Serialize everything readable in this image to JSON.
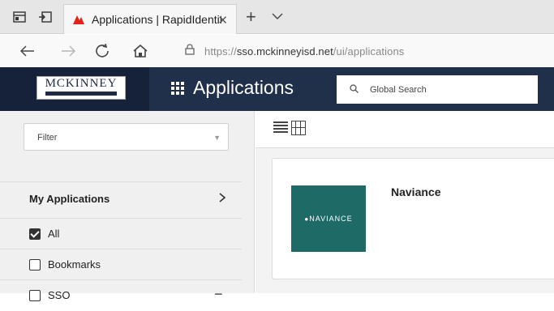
{
  "browser": {
    "tab_title": "Applications | RapidIdentity",
    "tab_favicon": "rapididentity-logo-icon",
    "accent": "#e2231a",
    "url_scheme": "https://",
    "url_host": "sso.mckinneyisd.net",
    "url_path": "/ui/applications"
  },
  "header": {
    "logo_text": "MCKINNEY",
    "title": "Applications",
    "search_placeholder": "Global Search",
    "background": "#20304b"
  },
  "sidebar": {
    "filter_label": "Filter",
    "section_title": "My Applications",
    "items": [
      {
        "label": "All",
        "checked": true
      },
      {
        "label": "Bookmarks",
        "checked": false
      },
      {
        "label": "SSO",
        "checked": false
      }
    ]
  },
  "main": {
    "apps": [
      {
        "name": "Naviance",
        "logo_text": "NAVIANCE",
        "logo_color": "#1d6a66"
      }
    ]
  }
}
